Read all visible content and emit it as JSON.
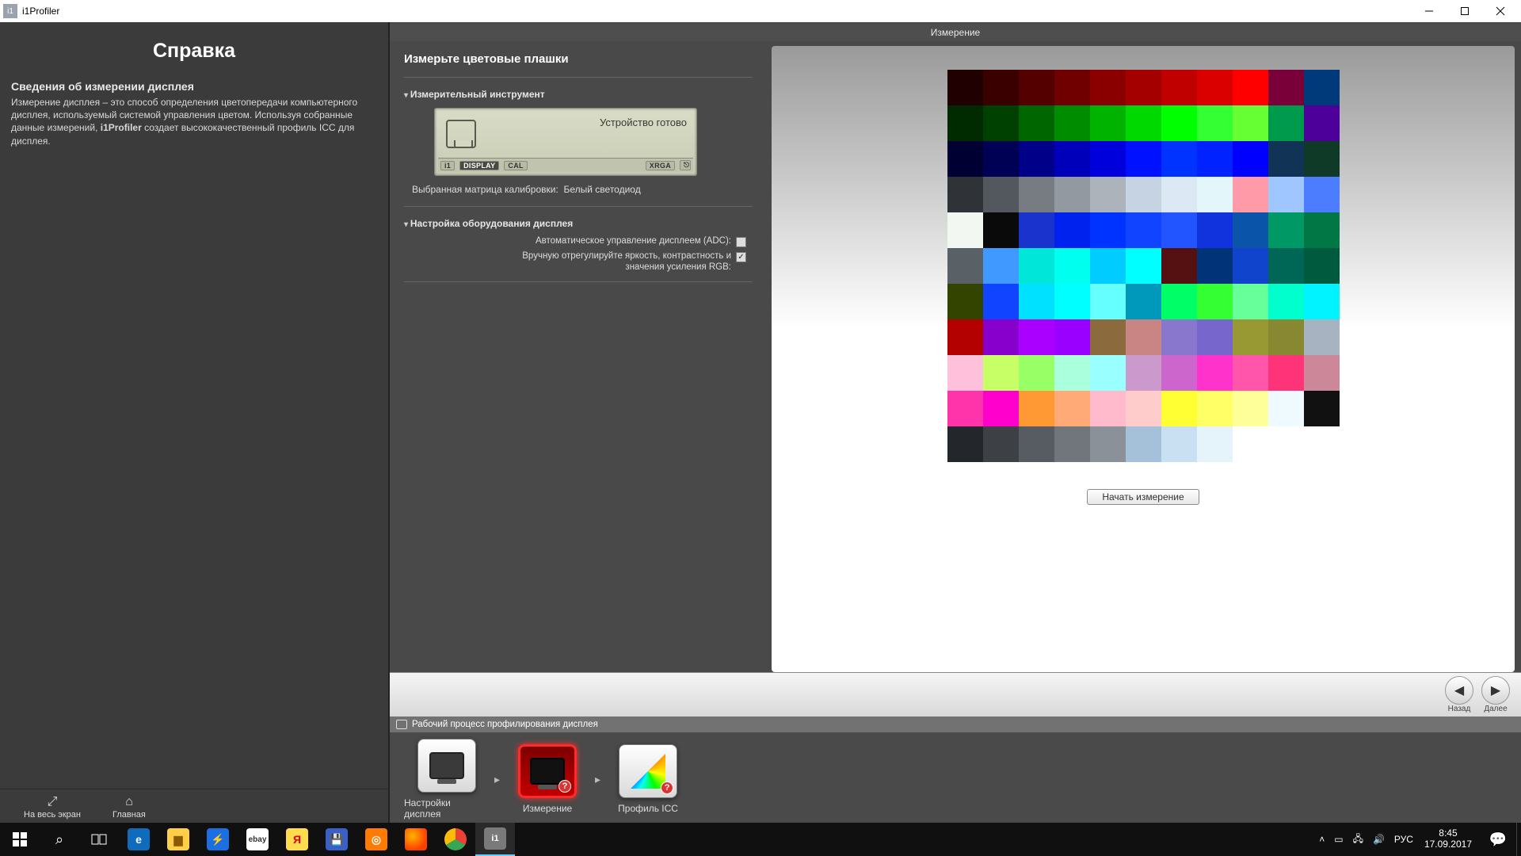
{
  "window": {
    "title": "i1Profiler"
  },
  "help": {
    "title": "Справка",
    "subtitle": "Сведения об измерении дисплея",
    "body_before": "Измерение дисплея – это способ определения цветопередачи компьютерного дисплея, используемый системой управления цветом. Используя собранные данные измерений, ",
    "body_bold": "i1Profiler",
    "body_after": " создает высококачественный профиль ICC для дисплея."
  },
  "bottom_left": {
    "fullscreen": "На весь экран",
    "home": "Главная"
  },
  "stage": {
    "tab_title": "Измерение",
    "heading": "Измерьте цветовые плашки",
    "section_instrument": "Измерительный инструмент",
    "device_status": "Устройство готово",
    "chips": {
      "i1": "i1",
      "display": "DISPLAY",
      "cal": "CAL",
      "xrga": "XRGA"
    },
    "matrix_label": "Выбранная матрица калибровки:",
    "matrix_value": "Белый светодиод",
    "section_hw": "Настройка оборудования дисплея",
    "opt_adc": "Автоматическое управление дисплеем (ADC):",
    "opt_manual": "Вручную отрегулируйте яркость, контрастность и значения усиления RGB:",
    "start_button": "Начать измерение"
  },
  "nav": {
    "back": "Назад",
    "next": "Далее"
  },
  "workflow": {
    "title": "Рабочий процесс профилирования дисплея",
    "step1": "Настройки дисплея",
    "step2": "Измерение",
    "step3": "Профиль ICC"
  },
  "patches": [
    "#200000",
    "#3a0000",
    "#550000",
    "#700000",
    "#8a0000",
    "#a50000",
    "#c00000",
    "#da0000",
    "#ff0000",
    "#7a003a",
    "#003a7a",
    "#002a00",
    "#004000",
    "#006600",
    "#008c00",
    "#00b300",
    "#00d900",
    "#00ff00",
    "#33ff33",
    "#66ff33",
    "#009a4d",
    "#4d009a",
    "#000033",
    "#000055",
    "#000088",
    "#0000bb",
    "#0000dd",
    "#0011ff",
    "#0033ff",
    "#0022ff",
    "#0000ff",
    "#113355",
    "#103a28",
    "#2f3338",
    "#53585e",
    "#777c82",
    "#9399a0",
    "#adb3ba",
    "#c6d3e3",
    "#dce9f5",
    "#e3f6fa",
    "#ff9aa8",
    "#9fc6ff",
    "#4d7dff",
    "#f2f7f2",
    "#0a0a0a",
    "#1a33cc",
    "#0022ee",
    "#0033ff",
    "#1144ff",
    "#2255ff",
    "#1133dd",
    "#0a55aa",
    "#009966",
    "#007744",
    "#5a6166",
    "#4099ff",
    "#00e6d9",
    "#00ffee",
    "#00ccff",
    "#00ffff",
    "#551111",
    "#003377",
    "#1144cc",
    "#006655",
    "#005a3e",
    "#334400",
    "#1144ff",
    "#00e0ff",
    "#00ffff",
    "#66ffff",
    "#0099bb",
    "#00ff66",
    "#33ff33",
    "#66ff99",
    "#00ffcc",
    "#00f3ff",
    "#b30000",
    "#8800cc",
    "#aa00ff",
    "#9900ff",
    "#8b6b3e",
    "#c98484",
    "#8877cc",
    "#7766cc",
    "#999933",
    "#888833",
    "#a8b3c2",
    "#ffc0dc",
    "#c6ff66",
    "#99ff66",
    "#aaffdd",
    "#99ffff",
    "#cc99cc",
    "#cc66cc",
    "#ff33cc",
    "#ff55aa",
    "#ff3377",
    "#cc8899",
    "#ff33aa",
    "#ff00cc",
    "#ff9933",
    "#ffaa77",
    "#ffbbcc",
    "#ffcccc",
    "#ffff33",
    "#ffff66",
    "#ffff99",
    "#eefaff",
    "#111111",
    "#23262a",
    "#3d4146",
    "#575c62",
    "#71767d",
    "#8b9199",
    "#a5c1da",
    "#c9e0f2",
    "#e5f3fb"
  ],
  "tray": {
    "lang": "РУС",
    "time": "8:45",
    "date": "17.09.2017"
  }
}
